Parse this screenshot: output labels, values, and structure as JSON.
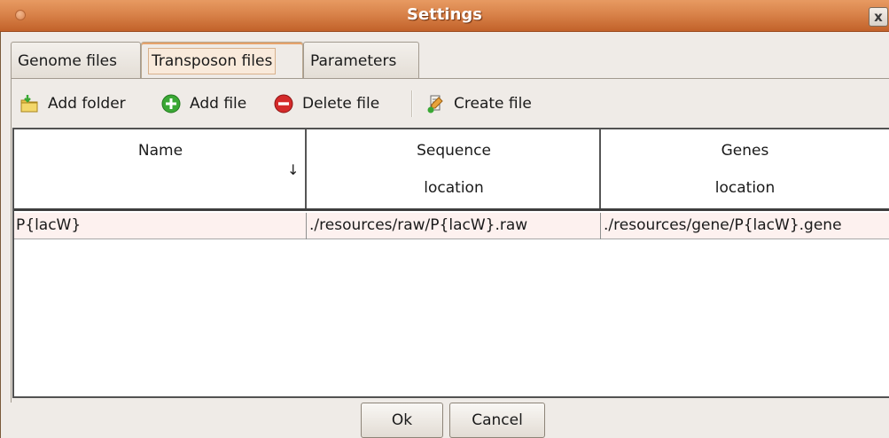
{
  "window": {
    "title": "Settings",
    "close_glyph": "x"
  },
  "tabs": [
    {
      "label": "Genome files",
      "active": false
    },
    {
      "label": "Transposon files",
      "active": true
    },
    {
      "label": "Parameters",
      "active": false
    }
  ],
  "toolbar": {
    "add_folder": {
      "label": "Add folder",
      "icon": "folder-add-icon"
    },
    "add_file": {
      "label": "Add file",
      "icon": "plus-circle-icon",
      "color": "#3aa835"
    },
    "delete_file": {
      "label": "Delete file",
      "icon": "minus-circle-icon",
      "color": "#d42a2a"
    },
    "create_file": {
      "label": "Create file",
      "icon": "create-file-icon"
    }
  },
  "table": {
    "columns": [
      {
        "line1": "Name",
        "line2": "",
        "sort_glyph": "↓"
      },
      {
        "line1": "Sequence",
        "line2": "location"
      },
      {
        "line1": "Genes",
        "line2": "location"
      }
    ],
    "rows": [
      {
        "name": "P{lacW}",
        "sequence_location": "./resources/raw/P{lacW}.raw",
        "genes_location": "./resources/gene/P{lacW}.gene"
      }
    ]
  },
  "buttons": {
    "ok": "Ok",
    "cancel": "Cancel"
  }
}
